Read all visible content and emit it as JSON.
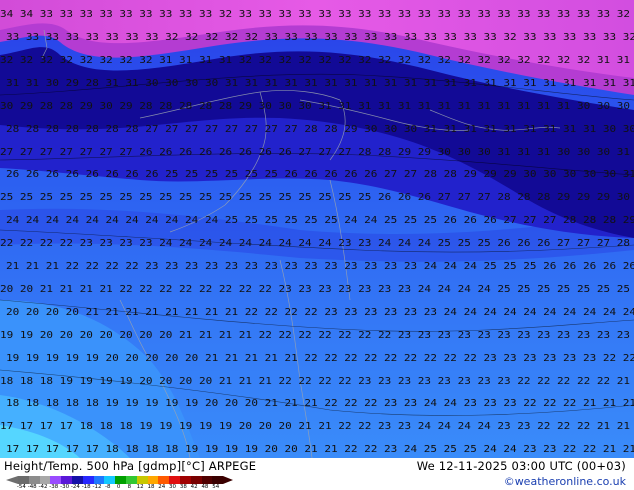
{
  "map": {
    "title": "Height/Temp. 500 hPa [gdmp][°C] ARPEGE",
    "valid_time": "We 12-11-2025 03:00 UTC (00+03)",
    "credit": "©weatheronline.co.uk",
    "colorbar": {
      "labels": [
        "-54",
        "-48",
        "-42",
        "-38",
        "-30",
        "-24",
        "-18",
        "-12",
        "-8",
        "0",
        "8",
        "12",
        "18",
        "24",
        "30",
        "38",
        "42",
        "48",
        "54"
      ],
      "colors": [
        "#6b6b6b",
        "#8c8c8c",
        "#a8a8a8",
        "#9a4cff",
        "#5a18d8",
        "#1410a8",
        "#2828ff",
        "#1e78ff",
        "#14c8ff",
        "#00a000",
        "#32c832",
        "#c8c800",
        "#ffa800",
        "#ff5a00",
        "#e01010",
        "#a00000",
        "#780000",
        "#500000",
        "#3a0000"
      ]
    },
    "field_colors": {
      "magenta": "#e65ae6",
      "purple": "#b43cd2",
      "navy": "#120a96",
      "darkblue": "#2222cc",
      "blue": "#2b5cf0",
      "lightblue": "#3ea0ff",
      "cyan": "#55d6ff"
    },
    "contour_rows": [
      {
        "text": "34 34 33 33 33 33 33 33 33 33 33 32 33 33 33 33 33 33 33 33 33 33 33 33 33 33 33 33 33 33 33 32"
      },
      {
        "text": "33 33 33 33 33 33 33 33 32 32 32 32 32 33 33 33 33 33 33 33 33 33 33 33 33 32 33 33 33 33 33 32"
      },
      {
        "text": "32 32 32 32 32 32 32 32 31 31 31 31 32 32 32 32 32 32 32 32 32 32 32 32 32 32 32 32 32 32 31 31"
      },
      {
        "text": "31 31 30 29 28 31 31 30 30 30 30 31 31 31 31 31 31 31 31 31 31 31 31 31 31 31 31 31 31 31 31 31"
      },
      {
        "text": "30 29 28 28 29 30 29 28 28 28 28 28 29 30 30 30 31 31 31 31 31 31 31 31 31 31 31 31 31 30 30 30"
      },
      {
        "text": "28 28 28 28 28 28 28 27 27 27 27 27 27 27 27 28 28 29 30 30 30 31 31 31 31 31 31 31 31 31 30 30"
      },
      {
        "text": "27 27 27 27 27 27 27 26 26 26 26 26 26 26 26 27 27 27 28 28 29 29 30 30 30 31 31 31 30 30 30 31"
      },
      {
        "text": "26 26 26 26 26 26 26 26 25 25 25 25 25 25 26 26 26 26 26 27 27 28 28 29 29 29 30 30 30 30 30 31"
      },
      {
        "text": "25 25 25 25 25 25 25 25 25 25 25 25 25 25 25 25 25 25 25 26 26 26 27 27 27 28 28 28 29 29 29 30"
      },
      {
        "text": "24 24 24 24 24 24 24 24 24 24 24 25 25 25 25 25 25 24 24 25 25 25 26 26 26 27 27 27 28 28 28 29"
      },
      {
        "text": "22 22 22 22 23 23 23 23 24 24 24 24 24 24 24 24 24 23 23 24 24 24 25 25 25 26 26 26 27 27 27 28"
      },
      {
        "text": "21 21 21 22 22 22 22 23 23 23 23 23 23 23 23 23 23 23 23 23 23 24 24 24 25 25 25 26 26 26 26 26"
      },
      {
        "text": "20 20 21 21 21 21 22 22 22 22 22 22 22 22 23 23 23 23 23 23 23 24 24 24 24 25 25 25 25 25 25 25"
      },
      {
        "text": "20 20 20 20 21 21 21 21 21 21 21 21 22 22 22 22 23 23 23 23 23 23 24 24 24 24 24 24 24 24 24 24"
      },
      {
        "text": "19 19 20 20 20 20 20 20 20 21 21 21 21 22 22 22 22 22 22 22 23 23 23 23 23 23 23 23 23 23 23 23"
      },
      {
        "text": "19 19 19 19 19 20 20 20 20 20 21 21 21 21 21 22 22 22 22 22 22 22 22 22 23 23 23 23 23 23 22 22"
      },
      {
        "text": "18 18 18 19 19 19 19 20 20 20 20 21 21 21 22 22 22 22 23 23 23 23 23 23 23 23 22 22 22 22 22 21"
      },
      {
        "text": "18 18 18 18 18 19 19 19 19 19 20 20 20 21 21 21 22 22 22 23 23 24 24 23 23 23 22 22 22 21 21 21"
      },
      {
        "text": "17 17 17 17 18 18 18 19 19 19 19 19 20 20 20 21 21 22 22 23 23 24 24 24 24 23 23 22 22 22 21 21"
      },
      {
        "text": "17 17 17 17 17 18 18 18 18 19 19 19 19 20 20 21 21 22 22 23 24 25 25 25 24 24 23 23 22 22 21 21"
      }
    ]
  }
}
